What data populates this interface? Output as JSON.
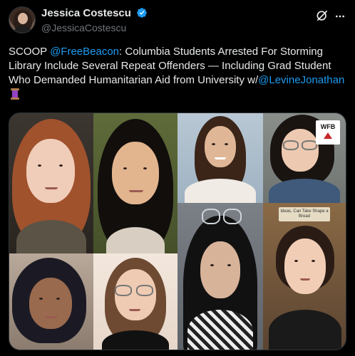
{
  "author": {
    "display_name": "Jessica Costescu",
    "handle": "@JessicaCostescu",
    "verified": true,
    "verified_color": "#1d9bf0"
  },
  "icons": {
    "grok": "grok-icon",
    "more": "more-icon",
    "verified": "verified-badge-icon",
    "spool": "thread-spool-emoji"
  },
  "tweet": {
    "part1": "SCOOP ",
    "mention1": "@FreeBeacon",
    "part2": ": Columbia Students Arrested For Storming Library Include Several Repeat Offenders — Including Grad Student Who Demanded Humanitarian Aid from University w/",
    "mention2": "@LevineJonathan",
    "link_color": "#1d9bf0"
  },
  "media": {
    "photo_count": 8,
    "badge_text": "WFB",
    "sign_text": "Ideas, Can Take Shape a Bread"
  }
}
